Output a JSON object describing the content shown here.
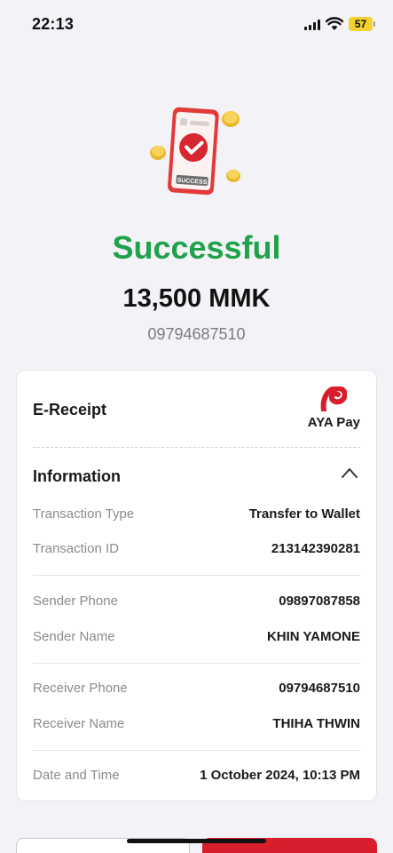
{
  "status_bar": {
    "time": "22:13",
    "battery": "57"
  },
  "hero": {
    "badge_text": "SUCCESS",
    "title": "Successful",
    "amount": "13,500 MMK",
    "phone": "09794687510"
  },
  "receipt": {
    "title": "E-Receipt",
    "brand": "AYA Pay",
    "section_title": "Information",
    "rows": [
      {
        "label": "Transaction Type",
        "value": "Transfer to Wallet"
      },
      {
        "label": "Transaction ID",
        "value": "213142390281"
      },
      {
        "label": "Sender Phone",
        "value": "09897087858"
      },
      {
        "label": "Sender Name",
        "value": "KHIN YAMONE"
      },
      {
        "label": "Receiver Phone",
        "value": "09794687510"
      },
      {
        "label": "Receiver Name",
        "value": "THIHA THWIN"
      },
      {
        "label": "Date and Time",
        "value": "1 October 2024, 10:13 PM"
      }
    ]
  },
  "colors": {
    "success": "#1fa24a",
    "brand_red": "#d81e2c",
    "background": "#f2f2f7"
  }
}
